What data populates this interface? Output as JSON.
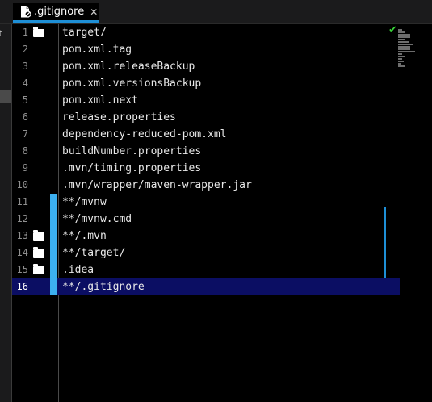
{
  "left_strip": {
    "fragment": "est"
  },
  "tab": {
    "filename": ".gitignore",
    "file_icon": "gitignore-file-icon",
    "close_glyph": "✕"
  },
  "status": {
    "check_glyph": "✔",
    "check_color": "#38d438"
  },
  "colors": {
    "accent": "#1e8fd6",
    "change_bar": "#3cb0f0",
    "current_line": "#0b0e63"
  },
  "editor": {
    "current_line": 16,
    "lines": [
      {
        "num": "1",
        "text": "target/",
        "fold": true,
        "changed": false
      },
      {
        "num": "2",
        "text": "pom.xml.tag",
        "fold": false,
        "changed": false
      },
      {
        "num": "3",
        "text": "pom.xml.releaseBackup",
        "fold": false,
        "changed": false
      },
      {
        "num": "4",
        "text": "pom.xml.versionsBackup",
        "fold": false,
        "changed": false
      },
      {
        "num": "5",
        "text": "pom.xml.next",
        "fold": false,
        "changed": false
      },
      {
        "num": "6",
        "text": "release.properties",
        "fold": false,
        "changed": false
      },
      {
        "num": "7",
        "text": "dependency-reduced-pom.xml",
        "fold": false,
        "changed": false
      },
      {
        "num": "8",
        "text": "buildNumber.properties",
        "fold": false,
        "changed": false
      },
      {
        "num": "9",
        "text": ".mvn/timing.properties",
        "fold": false,
        "changed": false
      },
      {
        "num": "10",
        "text": ".mvn/wrapper/maven-wrapper.jar",
        "fold": false,
        "changed": false
      },
      {
        "num": "11",
        "text": "**/mvnw",
        "fold": false,
        "changed": true
      },
      {
        "num": "12",
        "text": "**/mvnw.cmd",
        "fold": false,
        "changed": true
      },
      {
        "num": "13",
        "text": "**/.mvn",
        "fold": true,
        "changed": true
      },
      {
        "num": "14",
        "text": "**/target/",
        "fold": true,
        "changed": true
      },
      {
        "num": "15",
        "text": ".idea",
        "fold": true,
        "changed": true
      },
      {
        "num": "16",
        "text": "**/.gitignore",
        "fold": false,
        "changed": true
      }
    ]
  }
}
